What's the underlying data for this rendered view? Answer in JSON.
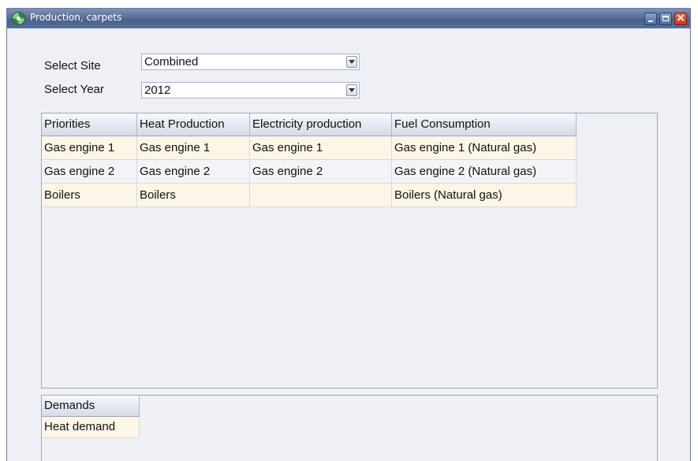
{
  "window": {
    "title": "Production, carpets",
    "icon": "app-icon"
  },
  "filters": {
    "site_label": "Select Site",
    "site_value": "Combined",
    "year_label": "Select Year",
    "year_value": "2012"
  },
  "priorities_table": {
    "columns": [
      "Priorities",
      "Heat Production",
      "Electricity production",
      "Fuel Consumption"
    ],
    "rows": [
      [
        "Gas engine 1",
        "Gas engine 1",
        "Gas engine 1",
        "Gas engine 1 (Natural gas)"
      ],
      [
        "Gas engine 2",
        "Gas engine 2",
        "Gas engine 2",
        "Gas engine 2 (Natural gas)"
      ],
      [
        "Boilers",
        "Boilers",
        "",
        "Boilers (Natural gas)"
      ]
    ]
  },
  "demands_table": {
    "columns": [
      "Demands"
    ],
    "rows": [
      [
        "Heat demand"
      ]
    ]
  },
  "colors": {
    "titlebar": "#5a7099",
    "row_highlight": "#fdf5e6",
    "window_bg": "#eef0f5"
  }
}
